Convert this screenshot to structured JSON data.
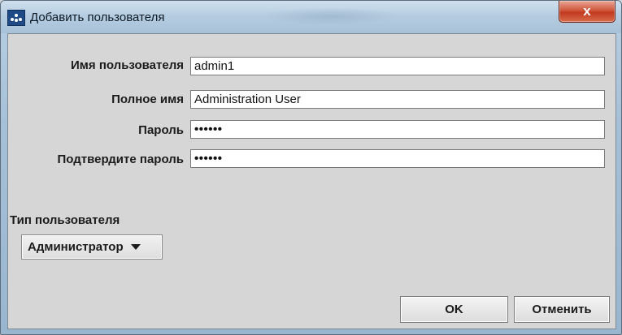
{
  "window": {
    "title": "Добавить пользователя",
    "close_glyph": "x"
  },
  "form": {
    "username_label": "Имя пользователя",
    "username_value": "admin1",
    "fullname_label": "Полное имя",
    "fullname_value": "Administration User",
    "password_label": "Пароль",
    "password_value": "••••••",
    "confirm_label": "Подтвердите пароль",
    "confirm_value": "••••••"
  },
  "user_type": {
    "label": "Тип пользователя",
    "selected": "Администратор"
  },
  "buttons": {
    "ok": "OK",
    "cancel": "Отменить"
  },
  "icons": {
    "app": "app-icon",
    "close": "close-icon",
    "dropdown": "chevron-down-icon"
  }
}
